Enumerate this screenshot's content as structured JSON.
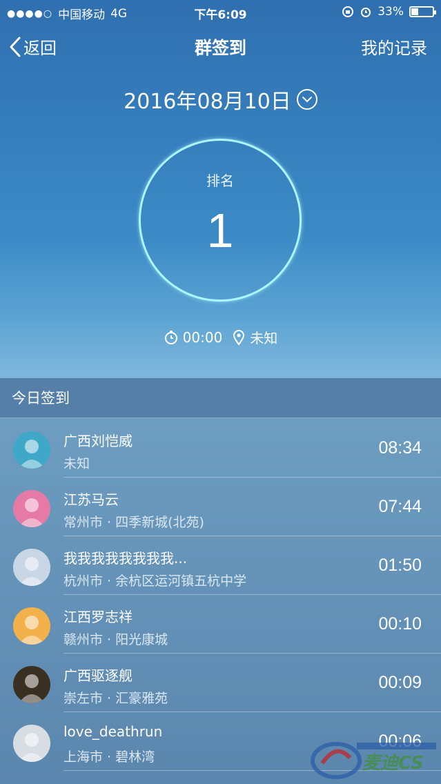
{
  "status_bar": {
    "signal": "●●●●○",
    "carrier": "中国移动",
    "network": "4G",
    "time": "下午6:09",
    "battery_percent": "33%",
    "battery_level": 0.33
  },
  "nav": {
    "back_label": "返回",
    "title": "群签到",
    "records_label": "我的记录"
  },
  "date": "2016年08月10日",
  "rank": {
    "label": "排名",
    "value": "1"
  },
  "info": {
    "time": "00:00",
    "location": "未知"
  },
  "section_title": "今日签到",
  "list": [
    {
      "name": "广西刘恺威",
      "location": "未知",
      "time": "08:34",
      "avatar_icon": "cartoon-boy-avatar",
      "avatar_color": "#3fa8c8"
    },
    {
      "name": "江苏马云",
      "location": "常州市 · 四季新城(北苑)",
      "time": "07:44",
      "avatar_icon": "harley-avatar",
      "avatar_color": "#e57aa6"
    },
    {
      "name": "我我我我我我我我...",
      "location": "杭州市 · 余杭区运河镇五杭中学",
      "time": "01:50",
      "avatar_icon": "anime-couple-avatar",
      "avatar_color": "#c9d6e6"
    },
    {
      "name": "江西罗志祥",
      "location": "赣州市 · 阳光康城",
      "time": "00:10",
      "avatar_icon": "anime-girl-avatar",
      "avatar_color": "#f2b14a"
    },
    {
      "name": "广西驱逐舰",
      "location": "崇左市 · 汇豪雅苑",
      "time": "00:09",
      "avatar_icon": "photo-avatar",
      "avatar_color": "#3a3022"
    },
    {
      "name": "love_deathrun",
      "location": "上海市 · 碧林湾",
      "time": "00:06",
      "avatar_icon": "airplane-avatar",
      "avatar_color": "#d8dde3"
    }
  ],
  "watermark_text": "麦迪CS"
}
